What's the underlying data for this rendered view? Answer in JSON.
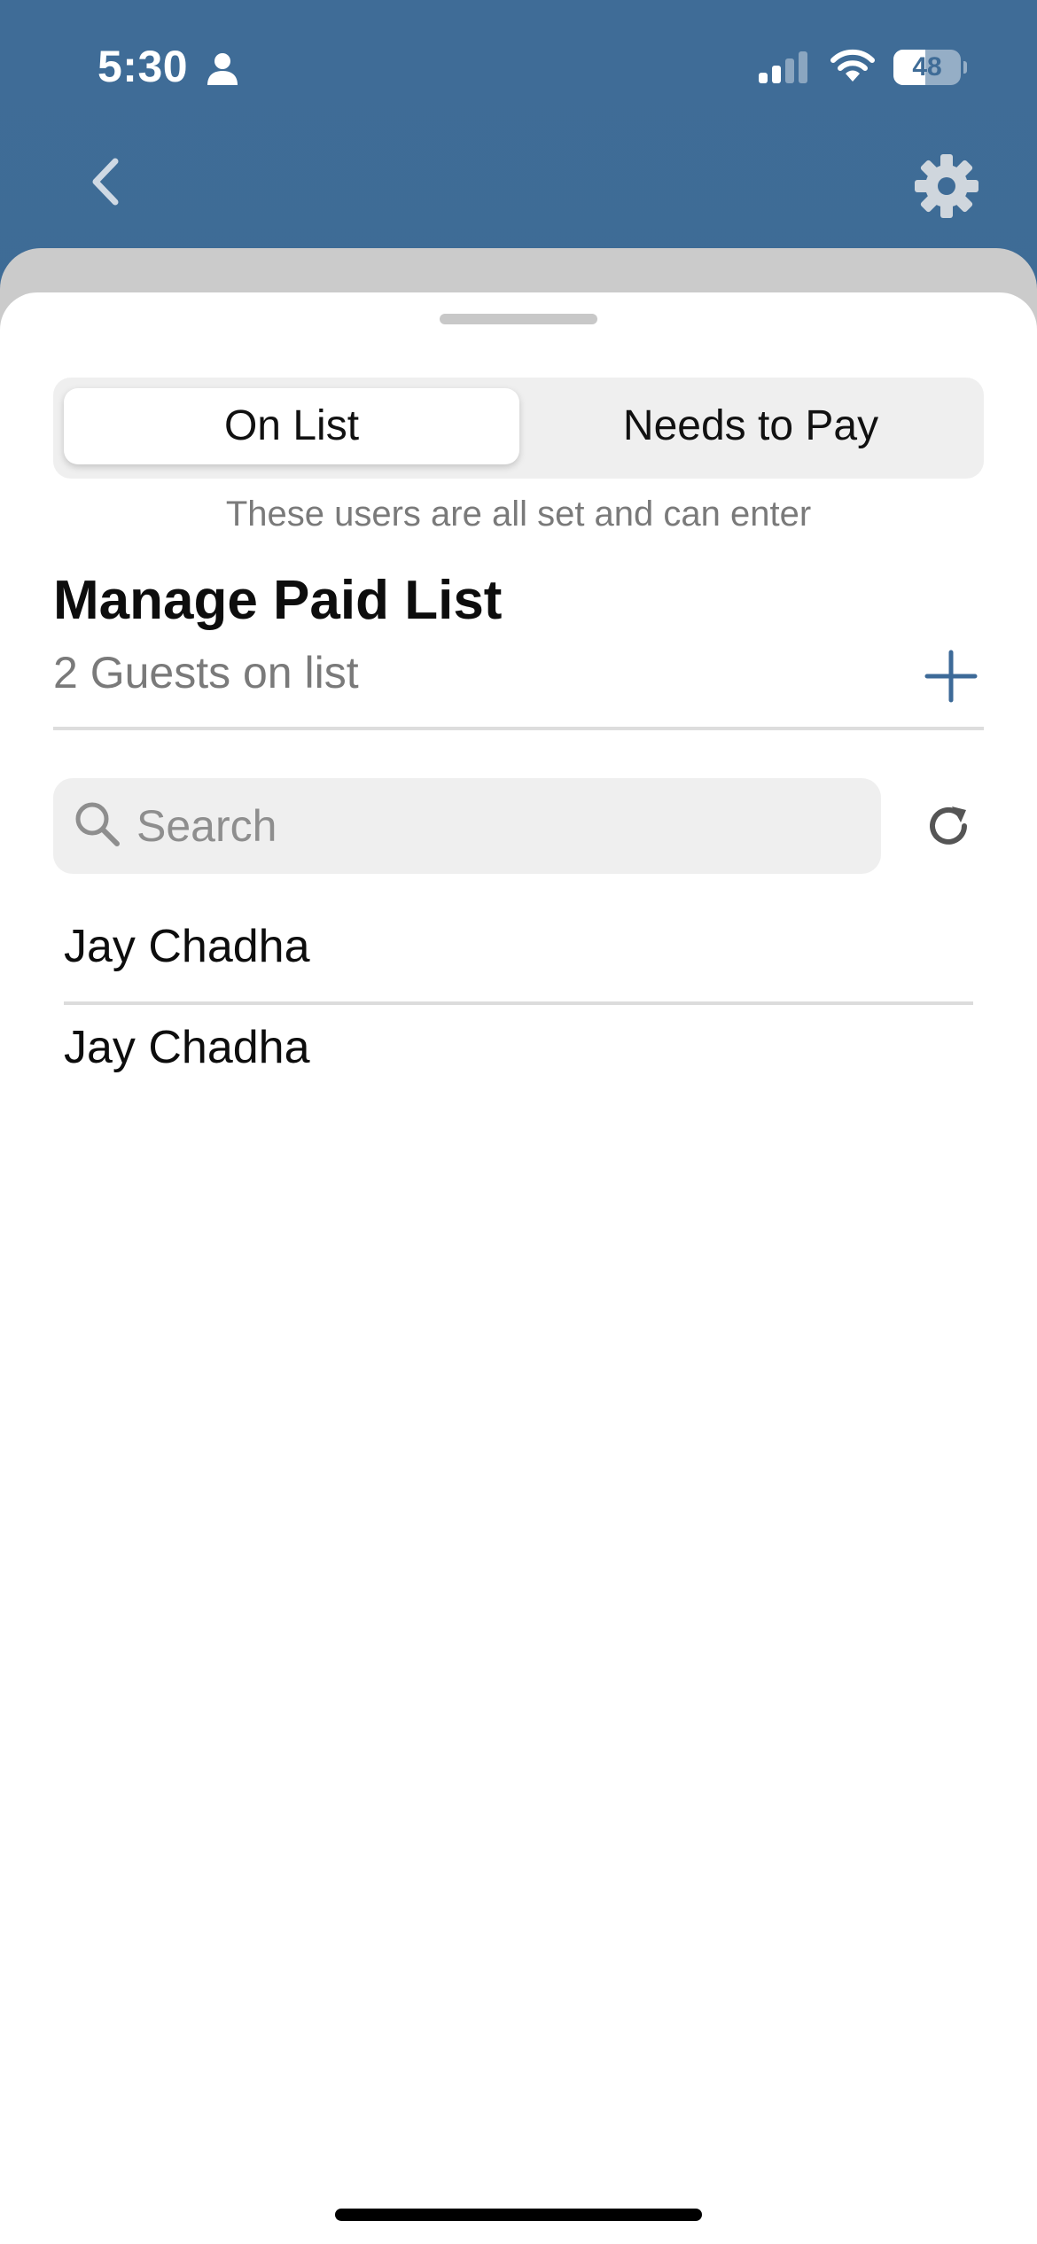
{
  "status_bar": {
    "time": "5:30",
    "battery": "48",
    "battery_level": 0.48
  },
  "nav": {
    "back_icon": "chevron-left-icon",
    "settings_icon": "gear-icon"
  },
  "segmented_control": {
    "active": "On List",
    "inactive": "Needs to Pay"
  },
  "helper_text": "These users are all set and can enter",
  "header": {
    "title": "Manage Paid List",
    "guest_count": "2 Guests on list",
    "add_icon": "plus-icon"
  },
  "search": {
    "placeholder": "Search",
    "value": "",
    "refresh_icon": "refresh-icon"
  },
  "guests": [
    {
      "name": "Jay Chadha"
    },
    {
      "name": "Jay Chadha"
    }
  ],
  "colors": {
    "header_blue": "#3f6c97",
    "accent_blue": "#3d6a98",
    "sheet_behind": "#cbcbcb"
  }
}
